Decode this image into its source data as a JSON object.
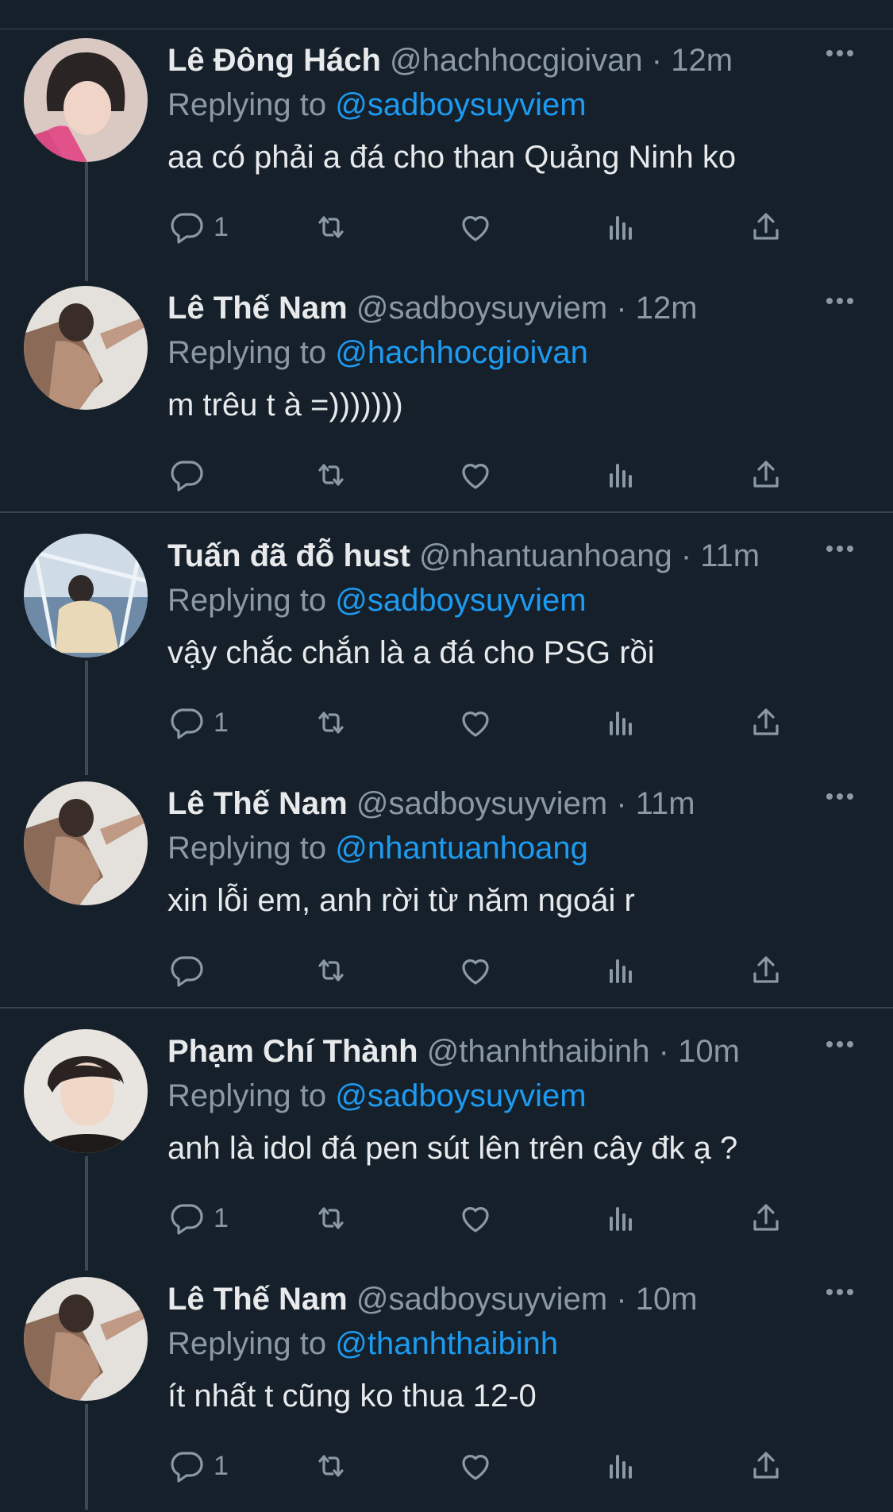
{
  "colors": {
    "background": "#15202b",
    "text": "#e7e9ea",
    "secondary": "#8b98a5",
    "link": "#1d9bf0",
    "divider": "#38444d"
  },
  "labels": {
    "replying_to": "Replying to",
    "separator": "·"
  },
  "tweets": [
    {
      "name": "Lê Đông Hách",
      "handle": "@hachhocgioivan",
      "time": "12m",
      "reply_to": "@sadboysuyviem",
      "text": "aa có phải a đá cho than Quảng Ninh ko",
      "reply_count": "1"
    },
    {
      "name": "Lê Thế Nam",
      "handle": "@sadboysuyviem",
      "time": "12m",
      "reply_to": "@hachhocgioivan",
      "text": "m trêu t à =)))))))",
      "reply_count": ""
    },
    {
      "name": "Tuấn đã đỗ hust",
      "handle": "@nhantuanhoang",
      "time": "11m",
      "reply_to": "@sadboysuyviem",
      "text": "vậy chắc chắn là a đá cho PSG rồi",
      "reply_count": "1"
    },
    {
      "name": "Lê Thế Nam",
      "handle": "@sadboysuyviem",
      "time": "11m",
      "reply_to": "@nhantuanhoang",
      "text": "xin lỗi em, anh rời từ năm ngoái r",
      "reply_count": ""
    },
    {
      "name": "Phạm Chí Thành",
      "handle": "@thanhthaibinh",
      "time": "10m",
      "reply_to": "@sadboysuyviem",
      "text": "anh là idol đá pen sút lên trên cây đk ạ ?",
      "reply_count": "1"
    },
    {
      "name": "Lê Thế Nam",
      "handle": "@sadboysuyviem",
      "time": "10m",
      "reply_to": "@thanhthaibinh",
      "text": "ít nhất t cũng ko thua 12-0",
      "reply_count": "1"
    }
  ]
}
